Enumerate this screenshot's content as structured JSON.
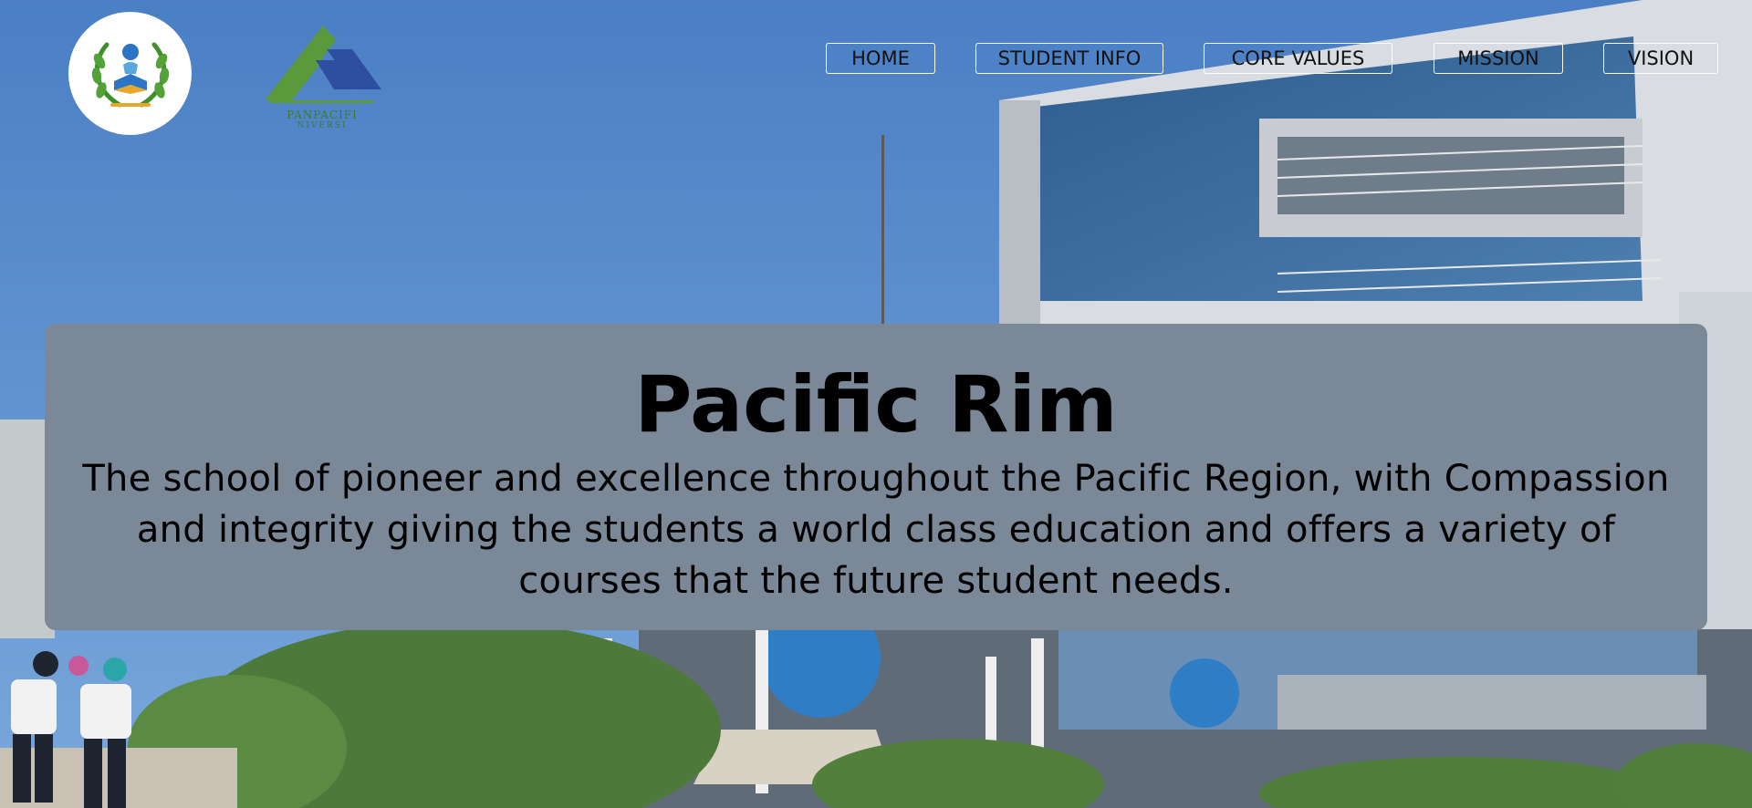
{
  "nav": {
    "items": [
      {
        "label": "HOME"
      },
      {
        "label": "STUDENT INFO"
      },
      {
        "label": "CORE VALUES"
      },
      {
        "label": "MISSION"
      },
      {
        "label": "VISION"
      }
    ]
  },
  "logos": {
    "school_seal_icon": "laurel-book-seal-icon",
    "brand_mark_icon": "panpacific-triangle-mark-icon",
    "brand_text_top": "PANPACIFI",
    "brand_text_bottom": "NIVERSI"
  },
  "hero": {
    "title": "Pacific Rim",
    "description": "The school of pioneer and excellence throughout the Pacific Region, with Compassion and integrity giving the students a world class education and offers a variety of courses that the future student needs."
  },
  "colors": {
    "sky": "#4f83c6",
    "hero_panel": "#7a8898",
    "brand_green": "#5a9a3a",
    "brand_blue": "#2e4fa0"
  }
}
